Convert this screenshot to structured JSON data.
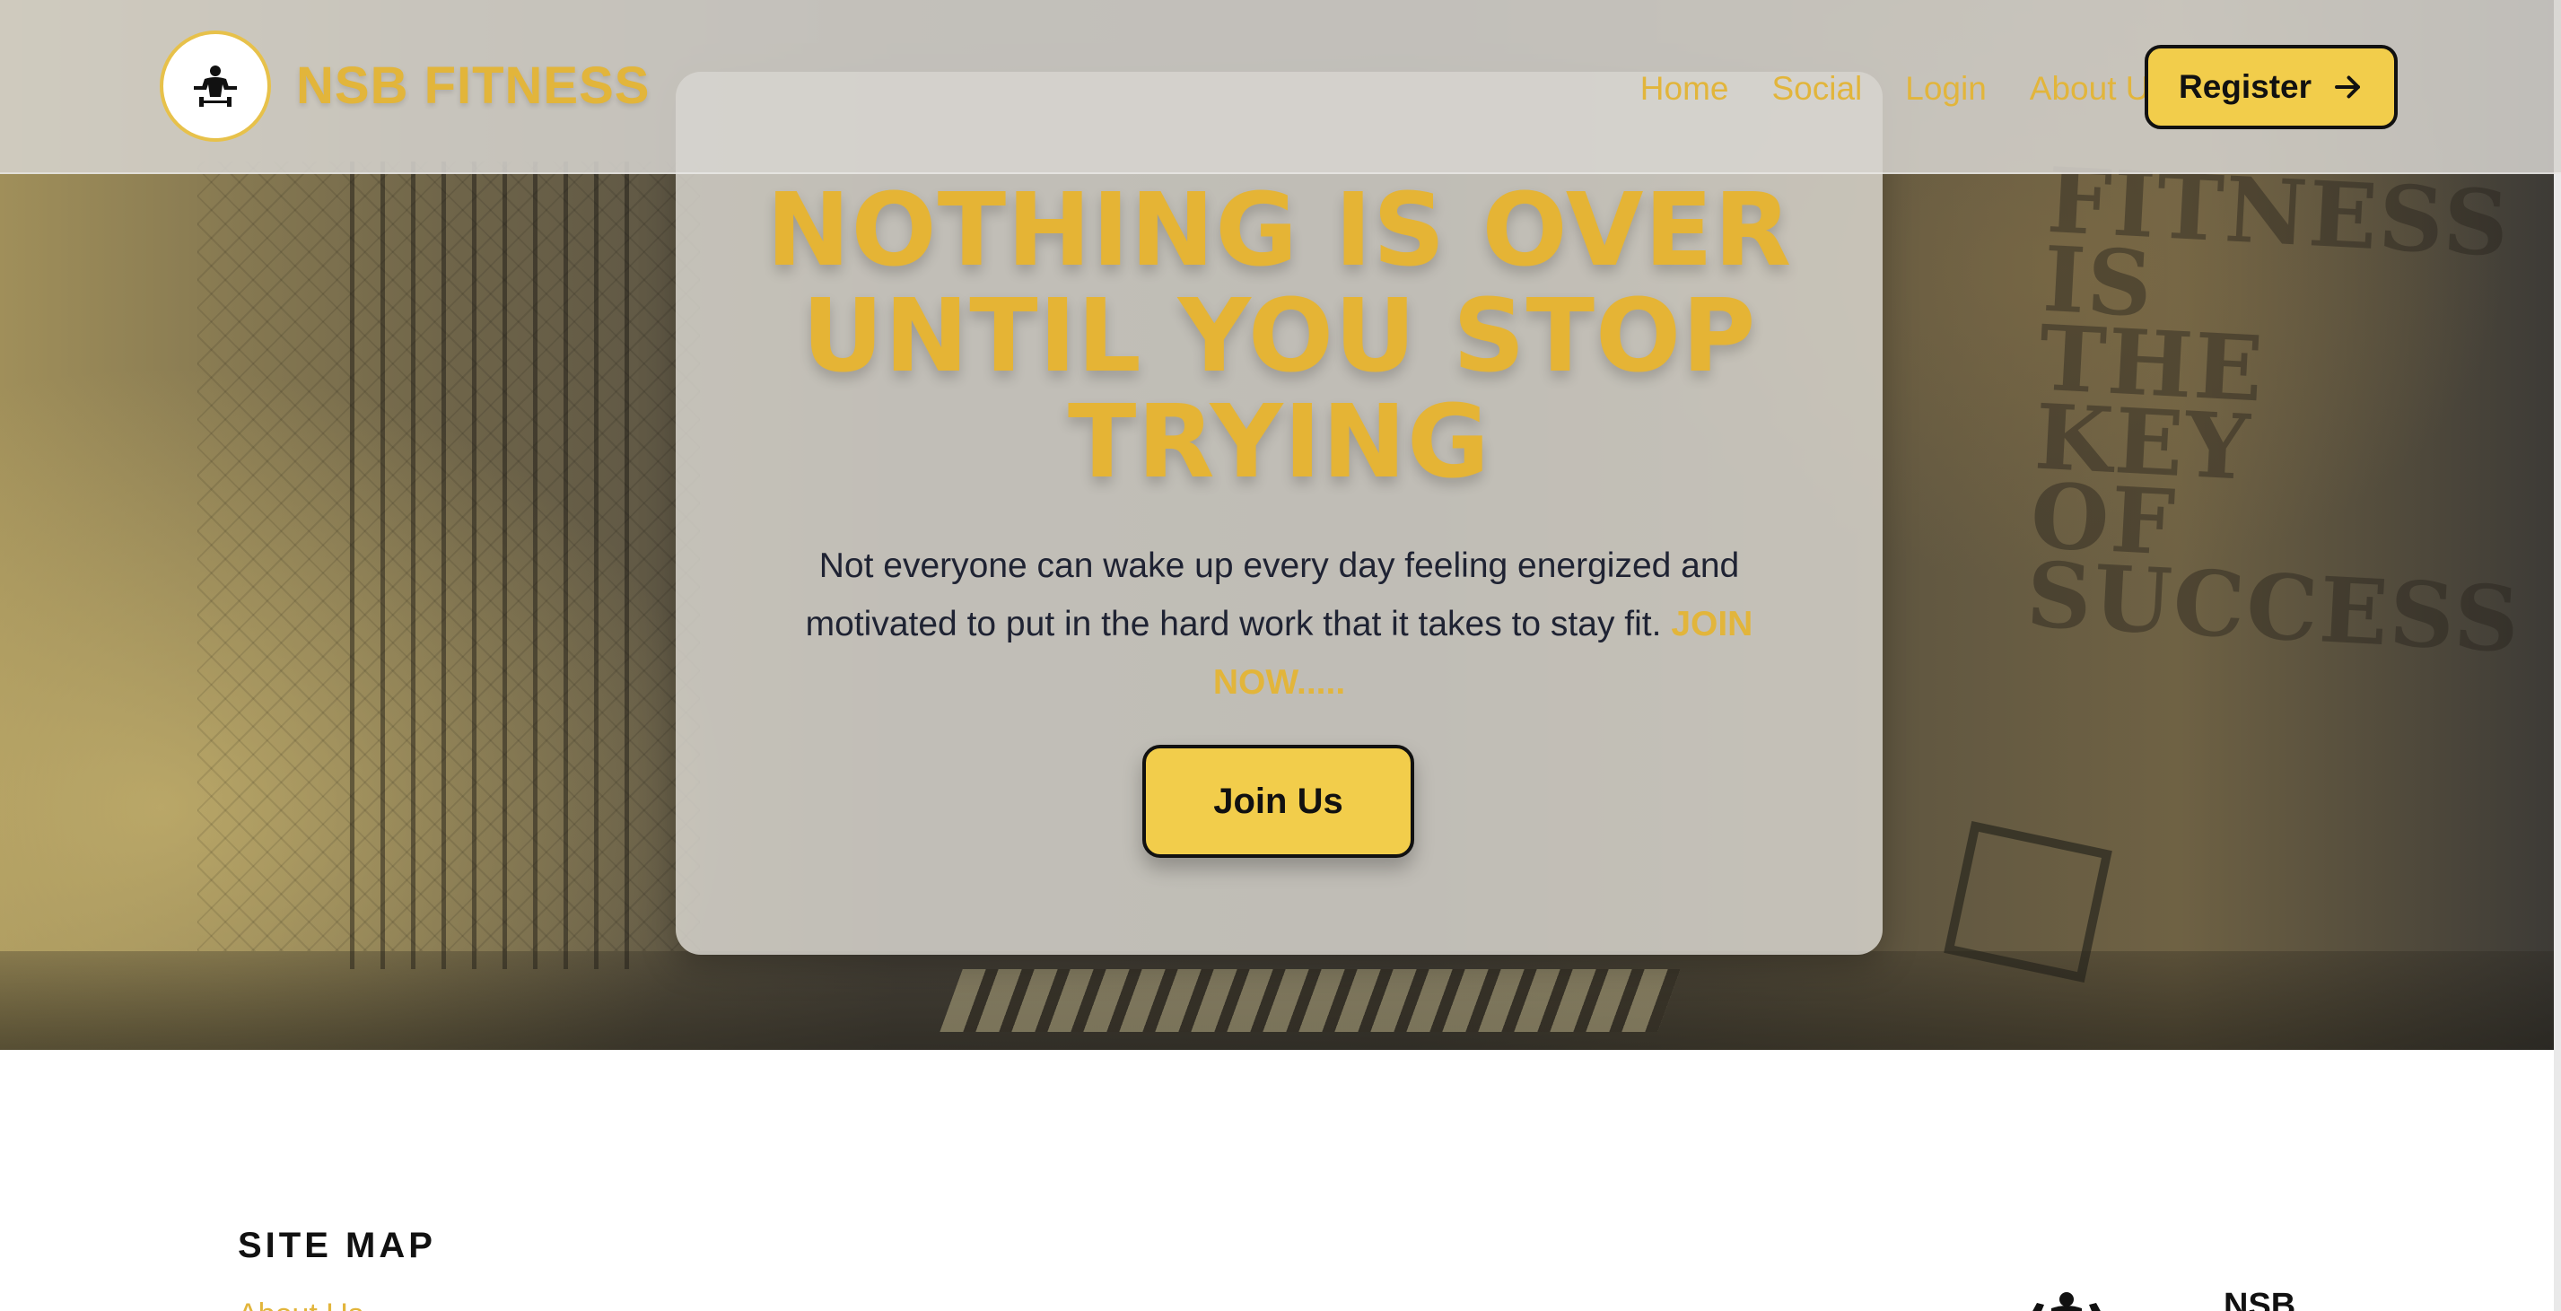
{
  "header": {
    "brand": "NSB FITNESS",
    "logo_icon": "bodybuilder-icon",
    "nav": [
      {
        "label": "Home"
      },
      {
        "label": "Social"
      },
      {
        "label": "Login"
      },
      {
        "label": "About Us"
      }
    ],
    "register_label": "Register",
    "register_icon": "arrow-right-icon"
  },
  "hero": {
    "title": "NOTHING IS OVER UNTIL YOU STOP TRYING",
    "text": "Not everyone can wake up every day feeling energized and motivated to put in the hard work that it takes to stay fit.",
    "text_accent": "JOIN NOW.....",
    "button_label": "Join Us",
    "wall_text": "FITNESS\nIS\nTHE\nKEY\nOF\nSUCCESS"
  },
  "footer": {
    "sitemap_title": "SITE MAP",
    "first_link": "About Us",
    "brand_partial": "NSB"
  },
  "colors": {
    "accent": "#e2b53b",
    "button": "#f2cd4b",
    "text_dark": "#1f2333"
  }
}
